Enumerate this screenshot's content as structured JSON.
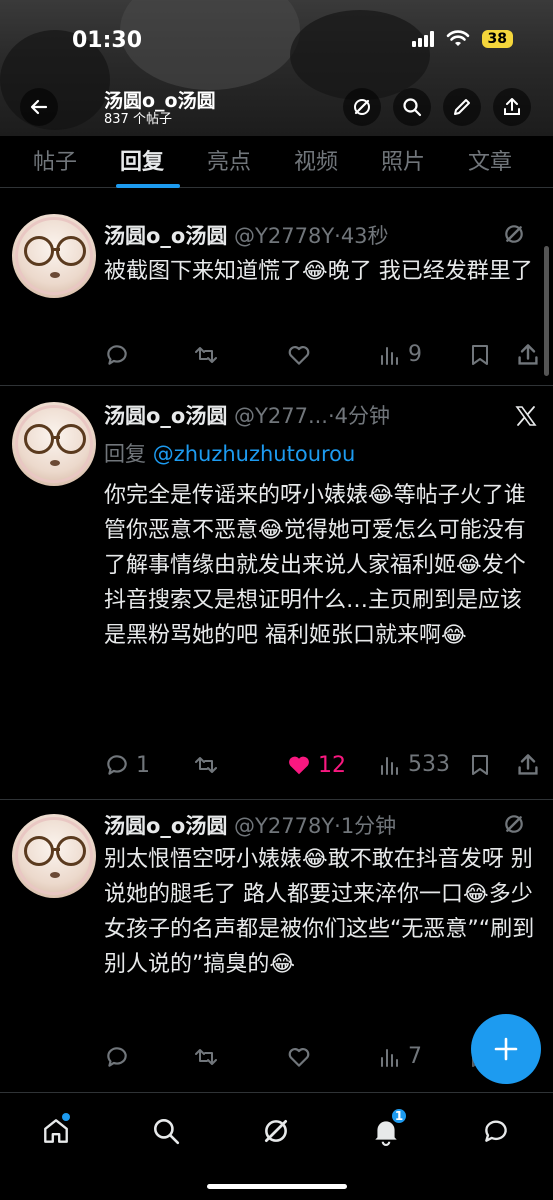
{
  "status": {
    "time": "01:30",
    "battery": "38"
  },
  "profile": {
    "name": "汤圆o_o汤圆",
    "posts_count": "837 个帖子"
  },
  "tabs": [
    {
      "label": "帖子"
    },
    {
      "label": "回复"
    },
    {
      "label": "亮点"
    },
    {
      "label": "视频"
    },
    {
      "label": "照片"
    },
    {
      "label": "文章"
    }
  ],
  "active_tab": "回复",
  "posts": [
    {
      "name": "汤圆o_o汤圆",
      "handle_time": "@Y2778Y·43秒",
      "reply_prefix": "",
      "mention": "",
      "text": "被截图下来知道慌了😂晚了 我已经发群里了",
      "replies": "",
      "reposts": "",
      "likes": "",
      "views": "9",
      "liked": false
    },
    {
      "name": "汤圆o_o汤圆",
      "handle_time": "@Y277...·4分钟",
      "reply_prefix": "回复",
      "mention": "@zhuzhuzhutourou",
      "text": "你完全是传谣来的呀小婊婊😂等帖子火了谁管你恶意不恶意😂觉得她可爱怎么可能没有了解事情缘由就发出来说人家福利姬😂发个抖音搜索又是想证明什么…主页刷到是应该是黑粉骂她的吧 福利姬张口就来啊😂",
      "replies": "1",
      "reposts": "",
      "likes": "12",
      "views": "533",
      "liked": true
    },
    {
      "name": "汤圆o_o汤圆",
      "handle_time": "@Y2778Y·1分钟",
      "reply_prefix": "",
      "mention": "",
      "text": "别太恨悟空呀小婊婊😂敢不敢在抖音发呀 别说她的腿毛了 路人都要过来淬你一口😂多少女孩子的名声都是被你们这些“无恶意”“刷到别人说的”搞臭的😂",
      "replies": "",
      "reposts": "",
      "likes": "",
      "views": "7",
      "liked": false
    }
  ],
  "nav": {
    "notifications_count": "1"
  },
  "colors": {
    "accent": "#1d9bf0",
    "like": "#f91880",
    "muted": "#71767b",
    "battery": "#f5d63b"
  }
}
